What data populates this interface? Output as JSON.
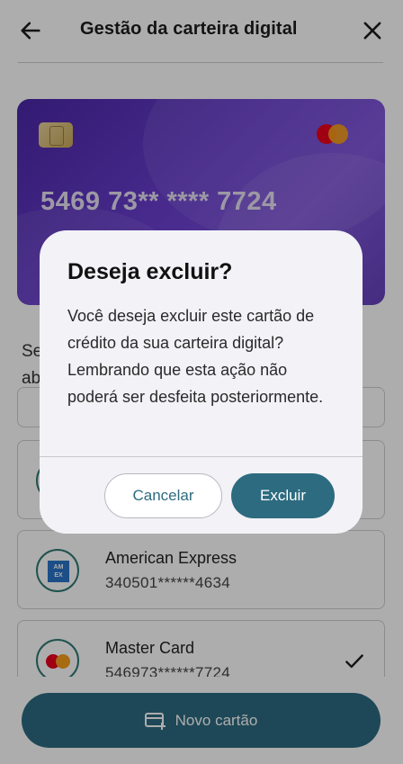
{
  "header": {
    "title": "Gestão da carteira digital"
  },
  "card": {
    "number": "5469 73** **** 7724"
  },
  "section_text_partial": [
    "Se",
    "ab"
  ],
  "cards_list": [
    {
      "name": "American Express",
      "number": "340501******4634",
      "icon": "amex-icon"
    },
    {
      "name": "Master Card",
      "number": "546973******7724",
      "icon": "mastercard-icon",
      "selected": true
    }
  ],
  "bottom": {
    "new_card_label": "Novo cartão"
  },
  "dialog": {
    "title": "Deseja excluir?",
    "body": "Você deseja excluir este cartão de crédito da sua carteira digital? Lembrando que esta ação não poderá ser desfeita posteriormente.",
    "cancel_label": "Cancelar",
    "confirm_label": "Excluir"
  },
  "colors": {
    "primary": "#2d6b80",
    "card_gradient_start": "#4b27a8",
    "card_gradient_end": "#7a4ddb"
  }
}
